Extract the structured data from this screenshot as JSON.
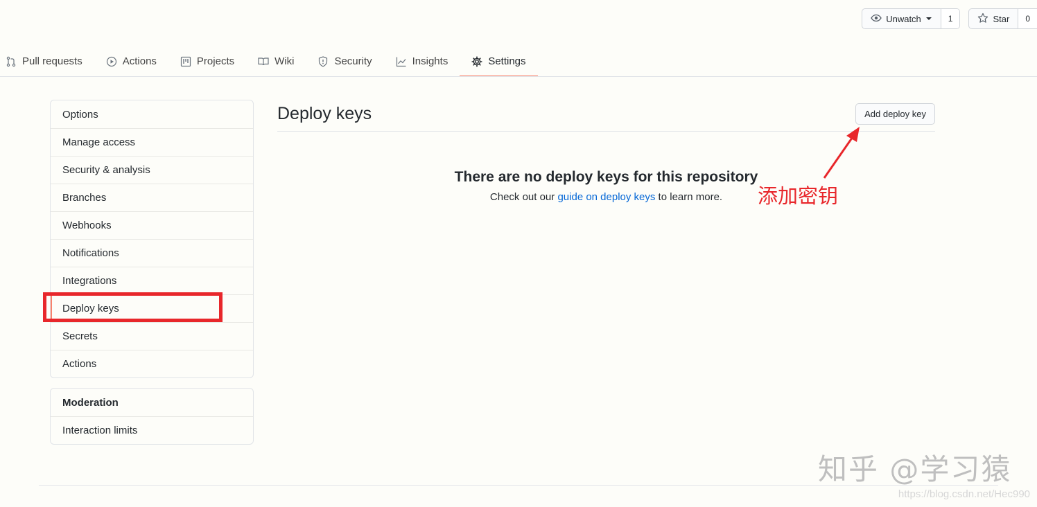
{
  "header": {
    "watch": {
      "label": "Unwatch",
      "count": "1"
    },
    "star": {
      "label": "Star",
      "count": "0"
    }
  },
  "tabs": [
    {
      "label": "Pull requests",
      "icon": "pull-request-icon"
    },
    {
      "label": "Actions",
      "icon": "play-icon"
    },
    {
      "label": "Projects",
      "icon": "project-icon"
    },
    {
      "label": "Wiki",
      "icon": "book-icon"
    },
    {
      "label": "Security",
      "icon": "shield-icon"
    },
    {
      "label": "Insights",
      "icon": "graph-icon"
    },
    {
      "label": "Settings",
      "icon": "gear-icon",
      "selected": true
    }
  ],
  "sidebar": {
    "items": [
      "Options",
      "Manage access",
      "Security & analysis",
      "Branches",
      "Webhooks",
      "Notifications",
      "Integrations",
      "Deploy keys",
      "Secrets",
      "Actions"
    ],
    "selected": "Deploy keys",
    "moderation": {
      "heading": "Moderation",
      "items": [
        "Interaction limits"
      ]
    }
  },
  "main": {
    "title": "Deploy keys",
    "add_button": "Add deploy key",
    "blank_title": "There are no deploy keys for this repository",
    "blank_text_before": "Check out our ",
    "blank_link": "guide on deploy keys",
    "blank_text_after": " to learn more."
  },
  "annotation": {
    "text": "添加密钥",
    "color": "#e8272b"
  },
  "watermark": {
    "text": "知乎 @学习猿",
    "url": "https://blog.csdn.net/Hec990"
  },
  "colors": {
    "accent": "#f9826c",
    "link": "#0366d6",
    "annotation": "#e8272b"
  }
}
